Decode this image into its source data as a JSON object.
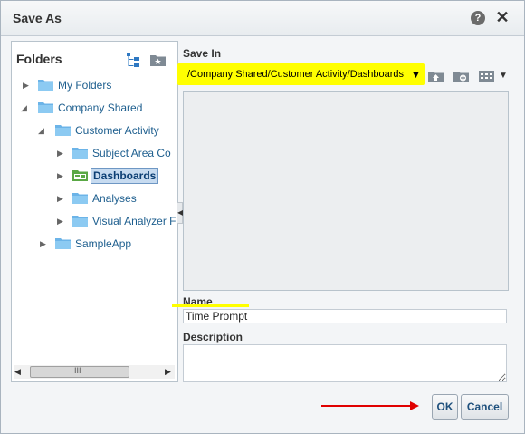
{
  "dialog": {
    "title": "Save As"
  },
  "folders": {
    "title": "Folders",
    "tree": [
      {
        "label": "My Folders",
        "expanded": false
      },
      {
        "label": "Company Shared",
        "expanded": true
      },
      {
        "label": "Customer Activity",
        "expanded": true
      },
      {
        "label": "Subject Area Co",
        "expanded": false
      },
      {
        "label": "Dashboards",
        "expanded": false,
        "selected": true
      },
      {
        "label": "Analyses",
        "expanded": false
      },
      {
        "label": "Visual Analyzer F",
        "expanded": false
      },
      {
        "label": "SampleApp",
        "expanded": false
      }
    ],
    "scroll_grip": "III"
  },
  "save_in": {
    "label": "Save In",
    "path": "/Company Shared/Customer Activity/Dashboards"
  },
  "name": {
    "label": "Name",
    "value": "Time Prompt"
  },
  "description": {
    "label": "Description",
    "value": ""
  },
  "buttons": {
    "ok": "OK",
    "cancel": "Cancel"
  },
  "colors": {
    "highlight": "#ffff00",
    "arrow": "#e00000",
    "folder": "#6cb4e8",
    "link": "#1d5e8e"
  }
}
